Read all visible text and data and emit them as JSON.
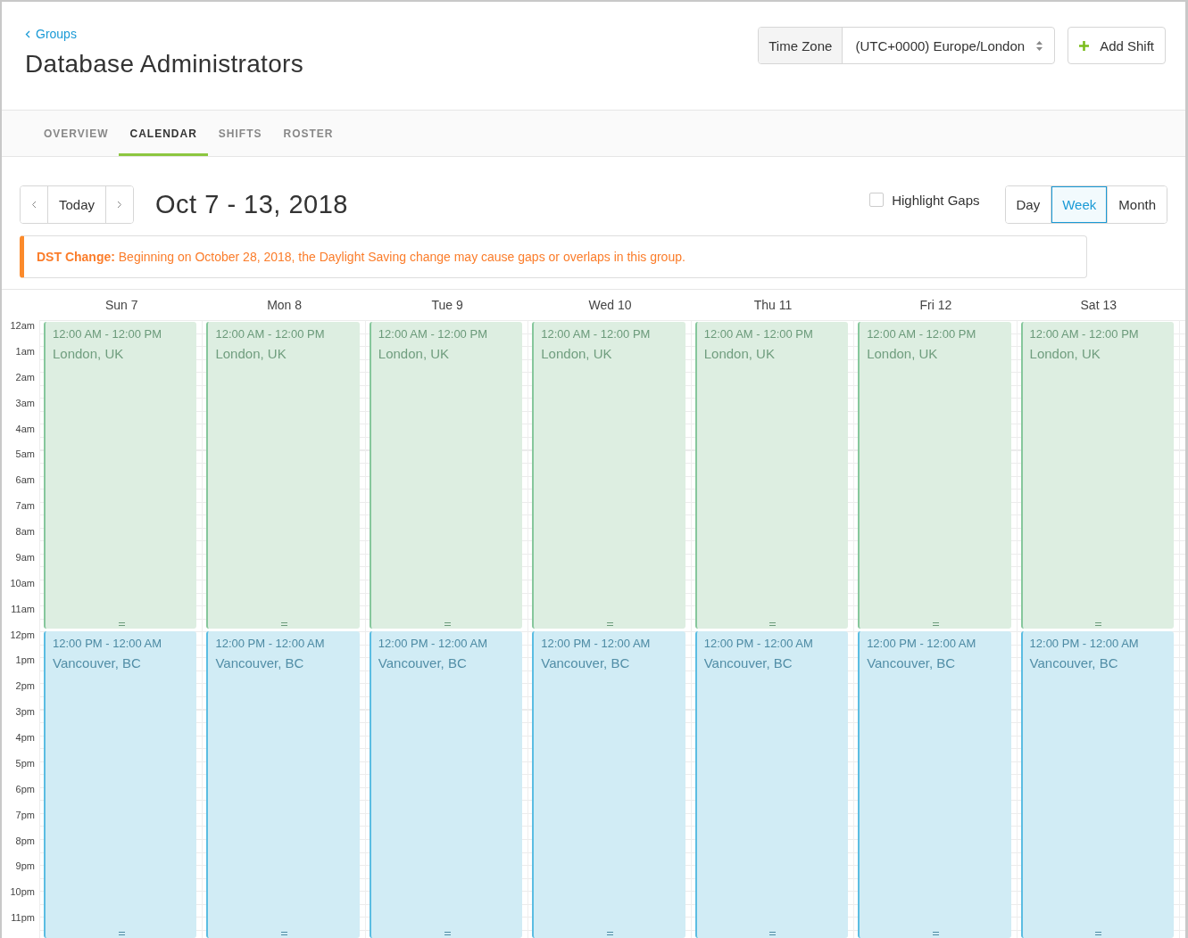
{
  "breadcrumb": {
    "label": "Groups"
  },
  "title": "Database Administrators",
  "time_zone": {
    "label": "Time Zone",
    "value": "(UTC+0000) Europe/London"
  },
  "add_button": {
    "label": "Add Shift"
  },
  "tabs": [
    {
      "label": "OVERVIEW",
      "selected": false
    },
    {
      "label": "CALENDAR",
      "selected": true
    },
    {
      "label": "SHIFTS",
      "selected": false
    },
    {
      "label": "ROSTER",
      "selected": false
    }
  ],
  "nav": {
    "today": "Today"
  },
  "range_title": "Oct 7 - 13, 2018",
  "highlight_gaps": {
    "label": "Highlight Gaps",
    "checked": false
  },
  "views": [
    {
      "label": "Day",
      "selected": false
    },
    {
      "label": "Week",
      "selected": true
    },
    {
      "label": "Month",
      "selected": false
    }
  ],
  "alert": {
    "text": "**DST Change:** Beginning on October 28, 2018, the Daylight Saving change may cause gaps or overlaps in this group."
  },
  "hours": [
    "12am",
    "1am",
    "2am",
    "3am",
    "4am",
    "5am",
    "6am",
    "7am",
    "8am",
    "9am",
    "10am",
    "11am",
    "12pm",
    "1pm",
    "2pm",
    "3pm",
    "4pm",
    "5pm",
    "6pm",
    "7pm",
    "8pm",
    "9pm",
    "10pm",
    "11pm"
  ],
  "days": [
    {
      "label": "Sun 7",
      "shifts": [
        {
          "time": "12:00 AM - 12:00 PM",
          "location": "London, UK",
          "kind": "london",
          "color": "#ddeee1"
        },
        {
          "time": "12:00 PM - 12:00 AM",
          "location": "Vancouver, BC",
          "kind": "vancouver",
          "color": "#d1ecf5"
        }
      ]
    },
    {
      "label": "Mon 8",
      "shifts": [
        {
          "time": "12:00 AM - 12:00 PM",
          "location": "London, UK",
          "kind": "london",
          "color": "#ddeee1"
        },
        {
          "time": "12:00 PM - 12:00 AM",
          "location": "Vancouver, BC",
          "kind": "vancouver",
          "color": "#d1ecf5"
        }
      ]
    },
    {
      "label": "Tue 9",
      "shifts": [
        {
          "time": "12:00 AM - 12:00 PM",
          "location": "London, UK",
          "kind": "london",
          "color": "#ddeee1"
        },
        {
          "time": "12:00 PM - 12:00 AM",
          "location": "Vancouver, BC",
          "kind": "vancouver",
          "color": "#d1ecf5"
        }
      ]
    },
    {
      "label": "Wed 10",
      "shifts": [
        {
          "time": "12:00 AM - 12:00 PM",
          "location": "London, UK",
          "kind": "london",
          "color": "#ddeee1"
        },
        {
          "time": "12:00 PM - 12:00 AM",
          "location": "Vancouver, BC",
          "kind": "vancouver",
          "color": "#d1ecf5"
        }
      ]
    },
    {
      "label": "Thu 11",
      "shifts": [
        {
          "time": "12:00 AM - 12:00 PM",
          "location": "London, UK",
          "kind": "london",
          "color": "#ddeee1"
        },
        {
          "time": "12:00 PM - 12:00 AM",
          "location": "Vancouver, BC",
          "kind": "vancouver",
          "color": "#d1ecf5"
        }
      ]
    },
    {
      "label": "Fri 12",
      "shifts": [
        {
          "time": "12:00 AM - 12:00 PM",
          "location": "London, UK",
          "kind": "london",
          "color": "#ddeee1"
        },
        {
          "time": "12:00 PM - 12:00 AM",
          "location": "Vancouver, BC",
          "kind": "vancouver",
          "color": "#d1ecf5"
        }
      ]
    },
    {
      "label": "Sat 13",
      "shifts": [
        {
          "time": "12:00 AM - 12:00 PM",
          "location": "London, UK",
          "kind": "london",
          "color": "#ddeee1"
        },
        {
          "time": "12:00 PM - 12:00 AM",
          "location": "Vancouver, BC",
          "kind": "vancouver",
          "color": "#d1ecf5"
        }
      ]
    }
  ]
}
